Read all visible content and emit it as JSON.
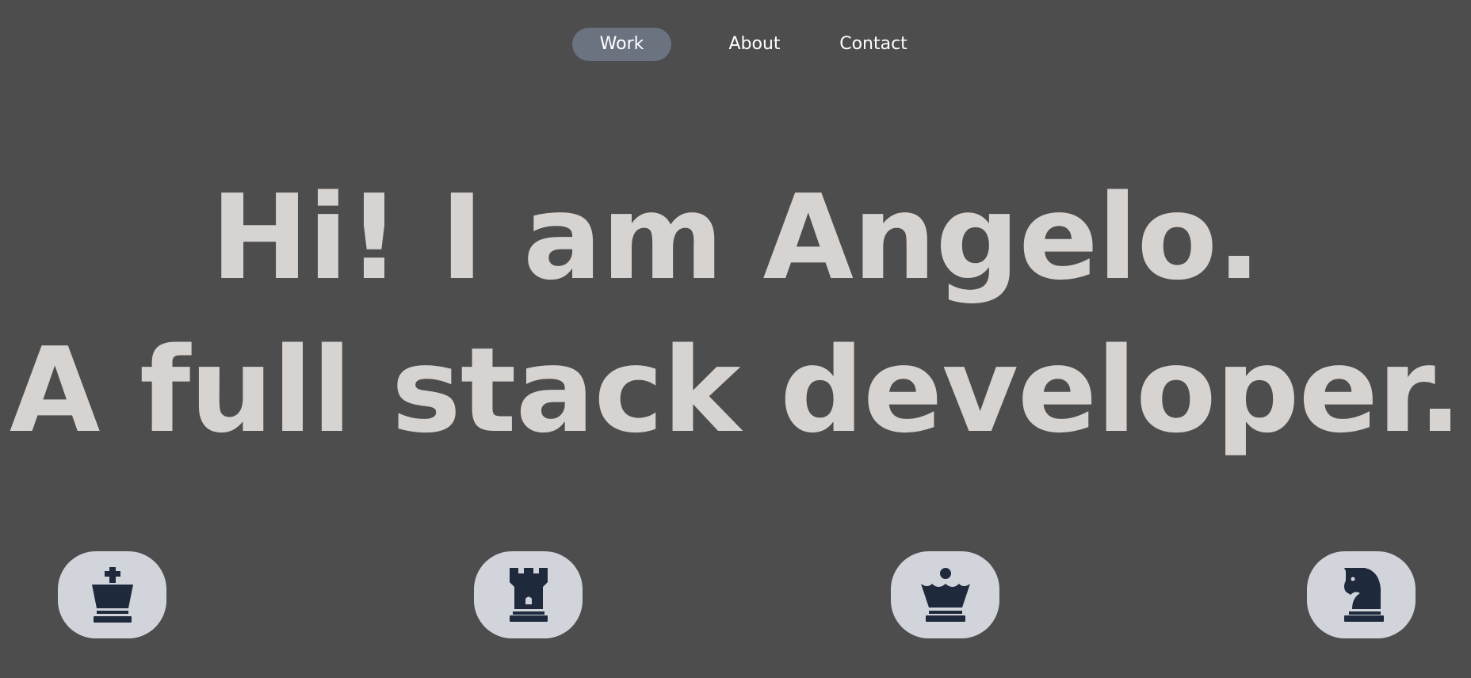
{
  "nav": {
    "items": [
      {
        "label": "Work",
        "active": true
      },
      {
        "label": "About",
        "active": false
      },
      {
        "label": "Contact",
        "active": false
      }
    ],
    "active_color": "#6b7280"
  },
  "hero": {
    "line1": "Hi! I am Angelo.",
    "line2": "A full stack developer."
  },
  "pieces": [
    {
      "icon": "chess-king-icon"
    },
    {
      "icon": "chess-rook-icon"
    },
    {
      "icon": "chess-queen-icon"
    },
    {
      "icon": "chess-knight-icon"
    }
  ],
  "colors": {
    "background": "#4d4d4d",
    "hero_text": "#d6d3d1",
    "button_bg": "#d1d5db",
    "icon": "#1e293b"
  }
}
